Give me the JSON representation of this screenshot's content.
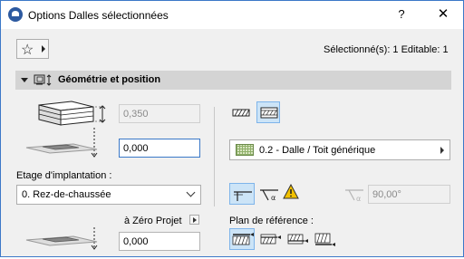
{
  "window": {
    "title": "Options Dalles sélectionnées",
    "help_label": "?",
    "close_label": "✕"
  },
  "toolbar": {
    "favorites_icon": "star-icon",
    "selection_info": "Sélectionné(s): 1 Editable: 1"
  },
  "section": {
    "label": "Géométrie et position",
    "expanded": true
  },
  "geometry": {
    "thickness_value": "0,350",
    "offset_value": "0,000",
    "story_label": "Etage d'implantation :",
    "story_value": "0. Rez-de-chaussée",
    "reference_label": "à Zéro Projet",
    "reference_value": "0,000"
  },
  "structure": {
    "material_value": "0.2 - Dalle / Toit générique",
    "angle_value": "90,00°",
    "ref_plane_label": "Plan de référence :"
  },
  "colors": {
    "accent": "#3a78c8",
    "selected_bg": "#cce4f7",
    "warning": "#f2c100"
  }
}
